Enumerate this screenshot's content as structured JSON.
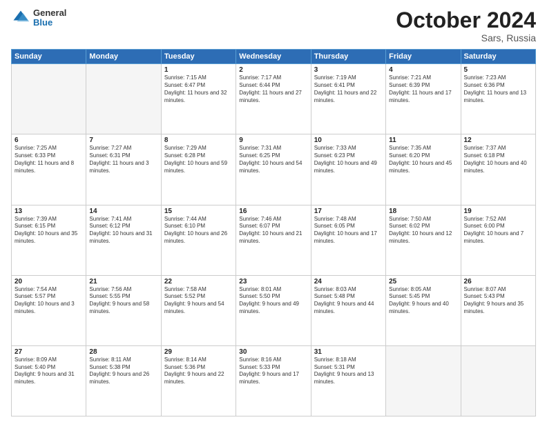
{
  "header": {
    "logo_general": "General",
    "logo_blue": "Blue",
    "title": "October 2024",
    "subtitle": "Sars, Russia"
  },
  "days_of_week": [
    "Sunday",
    "Monday",
    "Tuesday",
    "Wednesday",
    "Thursday",
    "Friday",
    "Saturday"
  ],
  "weeks": [
    [
      {
        "day": "",
        "sunrise": "",
        "sunset": "",
        "daylight": ""
      },
      {
        "day": "",
        "sunrise": "",
        "sunset": "",
        "daylight": ""
      },
      {
        "day": "1",
        "sunrise": "Sunrise: 7:15 AM",
        "sunset": "Sunset: 6:47 PM",
        "daylight": "Daylight: 11 hours and 32 minutes."
      },
      {
        "day": "2",
        "sunrise": "Sunrise: 7:17 AM",
        "sunset": "Sunset: 6:44 PM",
        "daylight": "Daylight: 11 hours and 27 minutes."
      },
      {
        "day": "3",
        "sunrise": "Sunrise: 7:19 AM",
        "sunset": "Sunset: 6:41 PM",
        "daylight": "Daylight: 11 hours and 22 minutes."
      },
      {
        "day": "4",
        "sunrise": "Sunrise: 7:21 AM",
        "sunset": "Sunset: 6:39 PM",
        "daylight": "Daylight: 11 hours and 17 minutes."
      },
      {
        "day": "5",
        "sunrise": "Sunrise: 7:23 AM",
        "sunset": "Sunset: 6:36 PM",
        "daylight": "Daylight: 11 hours and 13 minutes."
      }
    ],
    [
      {
        "day": "6",
        "sunrise": "Sunrise: 7:25 AM",
        "sunset": "Sunset: 6:33 PM",
        "daylight": "Daylight: 11 hours and 8 minutes."
      },
      {
        "day": "7",
        "sunrise": "Sunrise: 7:27 AM",
        "sunset": "Sunset: 6:31 PM",
        "daylight": "Daylight: 11 hours and 3 minutes."
      },
      {
        "day": "8",
        "sunrise": "Sunrise: 7:29 AM",
        "sunset": "Sunset: 6:28 PM",
        "daylight": "Daylight: 10 hours and 59 minutes."
      },
      {
        "day": "9",
        "sunrise": "Sunrise: 7:31 AM",
        "sunset": "Sunset: 6:25 PM",
        "daylight": "Daylight: 10 hours and 54 minutes."
      },
      {
        "day": "10",
        "sunrise": "Sunrise: 7:33 AM",
        "sunset": "Sunset: 6:23 PM",
        "daylight": "Daylight: 10 hours and 49 minutes."
      },
      {
        "day": "11",
        "sunrise": "Sunrise: 7:35 AM",
        "sunset": "Sunset: 6:20 PM",
        "daylight": "Daylight: 10 hours and 45 minutes."
      },
      {
        "day": "12",
        "sunrise": "Sunrise: 7:37 AM",
        "sunset": "Sunset: 6:18 PM",
        "daylight": "Daylight: 10 hours and 40 minutes."
      }
    ],
    [
      {
        "day": "13",
        "sunrise": "Sunrise: 7:39 AM",
        "sunset": "Sunset: 6:15 PM",
        "daylight": "Daylight: 10 hours and 35 minutes."
      },
      {
        "day": "14",
        "sunrise": "Sunrise: 7:41 AM",
        "sunset": "Sunset: 6:12 PM",
        "daylight": "Daylight: 10 hours and 31 minutes."
      },
      {
        "day": "15",
        "sunrise": "Sunrise: 7:44 AM",
        "sunset": "Sunset: 6:10 PM",
        "daylight": "Daylight: 10 hours and 26 minutes."
      },
      {
        "day": "16",
        "sunrise": "Sunrise: 7:46 AM",
        "sunset": "Sunset: 6:07 PM",
        "daylight": "Daylight: 10 hours and 21 minutes."
      },
      {
        "day": "17",
        "sunrise": "Sunrise: 7:48 AM",
        "sunset": "Sunset: 6:05 PM",
        "daylight": "Daylight: 10 hours and 17 minutes."
      },
      {
        "day": "18",
        "sunrise": "Sunrise: 7:50 AM",
        "sunset": "Sunset: 6:02 PM",
        "daylight": "Daylight: 10 hours and 12 minutes."
      },
      {
        "day": "19",
        "sunrise": "Sunrise: 7:52 AM",
        "sunset": "Sunset: 6:00 PM",
        "daylight": "Daylight: 10 hours and 7 minutes."
      }
    ],
    [
      {
        "day": "20",
        "sunrise": "Sunrise: 7:54 AM",
        "sunset": "Sunset: 5:57 PM",
        "daylight": "Daylight: 10 hours and 3 minutes."
      },
      {
        "day": "21",
        "sunrise": "Sunrise: 7:56 AM",
        "sunset": "Sunset: 5:55 PM",
        "daylight": "Daylight: 9 hours and 58 minutes."
      },
      {
        "day": "22",
        "sunrise": "Sunrise: 7:58 AM",
        "sunset": "Sunset: 5:52 PM",
        "daylight": "Daylight: 9 hours and 54 minutes."
      },
      {
        "day": "23",
        "sunrise": "Sunrise: 8:01 AM",
        "sunset": "Sunset: 5:50 PM",
        "daylight": "Daylight: 9 hours and 49 minutes."
      },
      {
        "day": "24",
        "sunrise": "Sunrise: 8:03 AM",
        "sunset": "Sunset: 5:48 PM",
        "daylight": "Daylight: 9 hours and 44 minutes."
      },
      {
        "day": "25",
        "sunrise": "Sunrise: 8:05 AM",
        "sunset": "Sunset: 5:45 PM",
        "daylight": "Daylight: 9 hours and 40 minutes."
      },
      {
        "day": "26",
        "sunrise": "Sunrise: 8:07 AM",
        "sunset": "Sunset: 5:43 PM",
        "daylight": "Daylight: 9 hours and 35 minutes."
      }
    ],
    [
      {
        "day": "27",
        "sunrise": "Sunrise: 8:09 AM",
        "sunset": "Sunset: 5:40 PM",
        "daylight": "Daylight: 9 hours and 31 minutes."
      },
      {
        "day": "28",
        "sunrise": "Sunrise: 8:11 AM",
        "sunset": "Sunset: 5:38 PM",
        "daylight": "Daylight: 9 hours and 26 minutes."
      },
      {
        "day": "29",
        "sunrise": "Sunrise: 8:14 AM",
        "sunset": "Sunset: 5:36 PM",
        "daylight": "Daylight: 9 hours and 22 minutes."
      },
      {
        "day": "30",
        "sunrise": "Sunrise: 8:16 AM",
        "sunset": "Sunset: 5:33 PM",
        "daylight": "Daylight: 9 hours and 17 minutes."
      },
      {
        "day": "31",
        "sunrise": "Sunrise: 8:18 AM",
        "sunset": "Sunset: 5:31 PM",
        "daylight": "Daylight: 9 hours and 13 minutes."
      },
      {
        "day": "",
        "sunrise": "",
        "sunset": "",
        "daylight": ""
      },
      {
        "day": "",
        "sunrise": "",
        "sunset": "",
        "daylight": ""
      }
    ]
  ]
}
